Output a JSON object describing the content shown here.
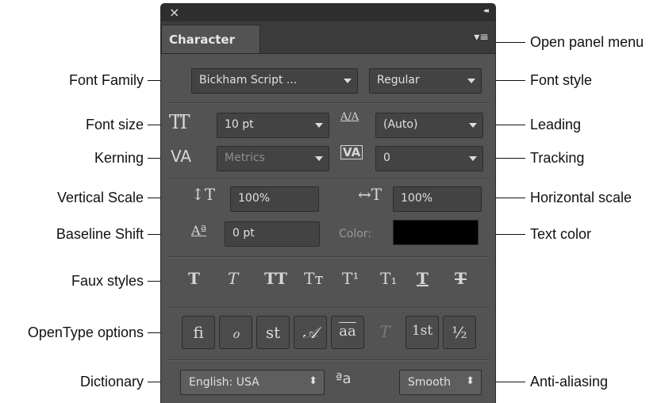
{
  "annotations": {
    "open_panel_menu": "Open panel menu",
    "font_family": "Font Family",
    "font_style": "Font style",
    "font_size": "Font size",
    "leading": "Leading",
    "kerning": "Kerning",
    "tracking": "Tracking",
    "vertical_scale": "Vertical Scale",
    "horizontal_scale": "Horizontal scale",
    "baseline_shift": "Baseline Shift",
    "text_color": "Text color",
    "faux_styles": "Faux styles",
    "opentype_options": "OpenType options",
    "dictionary": "Dictionary",
    "anti_aliasing": "Anti-aliasing"
  },
  "panel": {
    "close_glyph": "×",
    "collapse_glyph": "◂◂",
    "tab_label": "Character",
    "menu_glyph": "▾≡",
    "font_family": "Bickham Script ...",
    "font_style": "Regular",
    "font_size": "10 pt",
    "leading": "(Auto)",
    "kerning": "Metrics",
    "tracking": "0",
    "vertical_scale": "100%",
    "horizontal_scale": "100%",
    "baseline_shift": "0 pt",
    "color_label": "Color:",
    "text_color_value": "#000000",
    "dictionary": "English: USA",
    "dictionary_arrows": "⬍",
    "aa_glyph": "ªa",
    "anti_aliasing": "Smooth",
    "aa_arrows": "⬍",
    "faux_styles": [
      {
        "name": "faux-bold",
        "glyph": "T"
      },
      {
        "name": "faux-italic",
        "glyph": "T"
      },
      {
        "name": "all-caps",
        "glyph": "TT"
      },
      {
        "name": "small-caps",
        "glyph": "Tт"
      },
      {
        "name": "superscript",
        "glyph": "T¹"
      },
      {
        "name": "subscript",
        "glyph": "T₁"
      },
      {
        "name": "underline",
        "glyph": "T"
      },
      {
        "name": "strikethrough",
        "glyph": "T"
      }
    ],
    "opentype": [
      {
        "name": "standard-ligatures",
        "glyph": "fi"
      },
      {
        "name": "contextual-alternates",
        "glyph": "ℴ"
      },
      {
        "name": "discretionary-ligatures",
        "glyph": "st"
      },
      {
        "name": "swash",
        "glyph": "𝒜"
      },
      {
        "name": "stylistic-alternates",
        "glyph": "aa"
      },
      {
        "name": "titling-alternates",
        "glyph": "T"
      },
      {
        "name": "ordinals",
        "glyph": "1st"
      },
      {
        "name": "fractions",
        "glyph": "½"
      }
    ],
    "icons": {
      "font_size": "TT",
      "leading": "A/A",
      "kerning": "VA",
      "tracking": "VA",
      "vertical_scale": "↕T",
      "horizontal_scale": "↔T",
      "baseline_shift": "Aª"
    }
  }
}
